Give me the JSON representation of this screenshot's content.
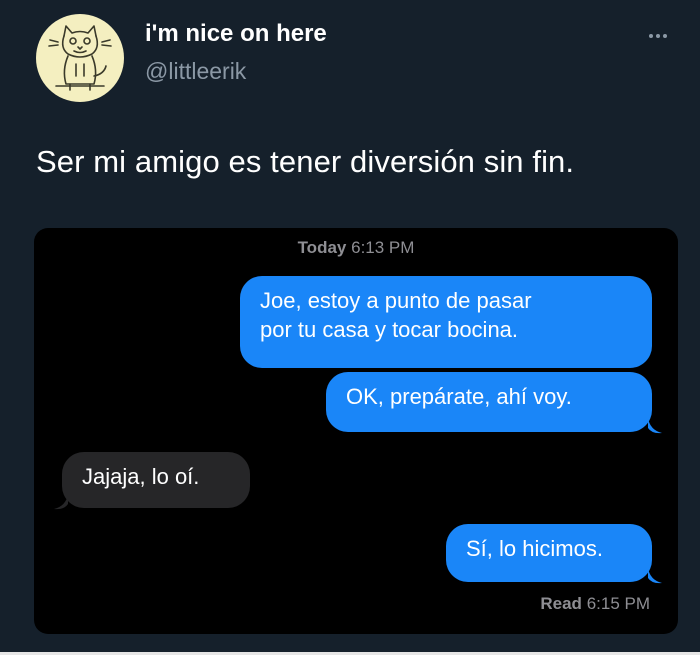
{
  "tweet": {
    "display_name": "i'm nice on here",
    "handle": "@littleerik",
    "text": "Ser mi amigo es tener diversión sin fin.",
    "more_icon": "more-horizontal-icon"
  },
  "messages_screenshot": {
    "timestamp_day": "Today",
    "timestamp_time": "6:13 PM",
    "messages": [
      {
        "direction": "sent",
        "lines": [
          "Joe, estoy a punto de pasar",
          "por tu casa y tocar bocina."
        ]
      },
      {
        "direction": "sent",
        "lines": [
          "OK, prepárate, ahí voy."
        ]
      },
      {
        "direction": "received",
        "lines": [
          "Jajaja, lo oí."
        ]
      },
      {
        "direction": "sent",
        "lines": [
          "Sí, lo hicimos."
        ]
      }
    ],
    "read_label": "Read",
    "read_time": "6:15 PM"
  },
  "colors": {
    "background": "#15202b",
    "sent_bubble": "#1a86f8",
    "received_bubble": "#262628",
    "secondary_text": "#8b98a5"
  }
}
